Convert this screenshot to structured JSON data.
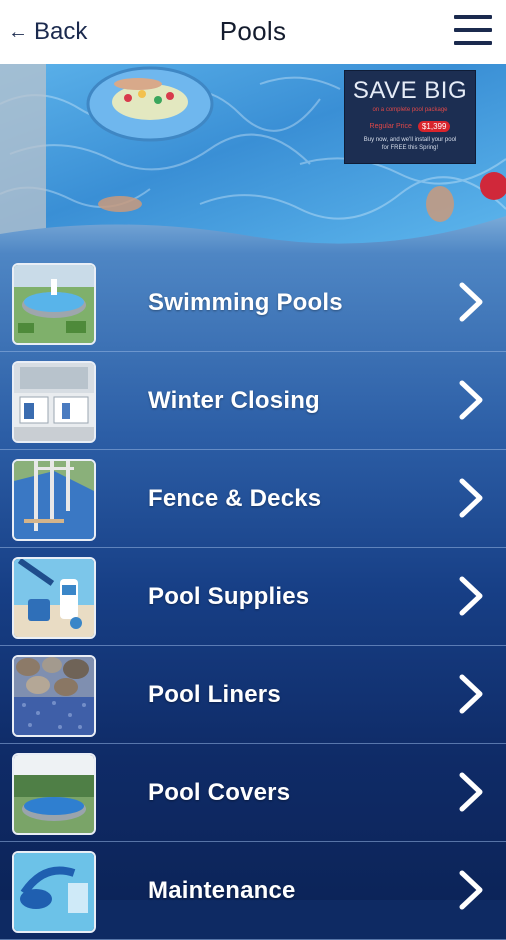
{
  "header": {
    "back_label": "Back",
    "back_icon": "arrow-left-icon",
    "title": "Pools",
    "menu_icon": "hamburger-menu-icon"
  },
  "hero": {
    "promo": {
      "headline": "SAVE BIG",
      "subline": "on a complete pool package",
      "was_text": "Regular Price",
      "price": "$1,399",
      "note_line1": "Buy now, and we'll install your pool",
      "note_line2": "for FREE this Spring!"
    }
  },
  "menu": {
    "items": [
      {
        "label": "Swimming Pools",
        "thumb": "above-ground-pool-photo"
      },
      {
        "label": "Winter Closing",
        "thumb": "pool-store-photo"
      },
      {
        "label": "Fence & Decks",
        "thumb": "pool-fence-photo"
      },
      {
        "label": "Pool Supplies",
        "thumb": "pool-supplies-photo"
      },
      {
        "label": "Pool Liners",
        "thumb": "pool-liner-pattern-photo"
      },
      {
        "label": "Pool Covers",
        "thumb": "pool-cover-photo"
      },
      {
        "label": "Maintenance",
        "thumb": "maintenance-photo"
      }
    ]
  },
  "colors": {
    "header_bg": "#ffffff",
    "header_text": "#1b2a4e",
    "list_top": "#4e86c4",
    "list_bottom": "#0c2459",
    "label_text": "#ffffff"
  }
}
